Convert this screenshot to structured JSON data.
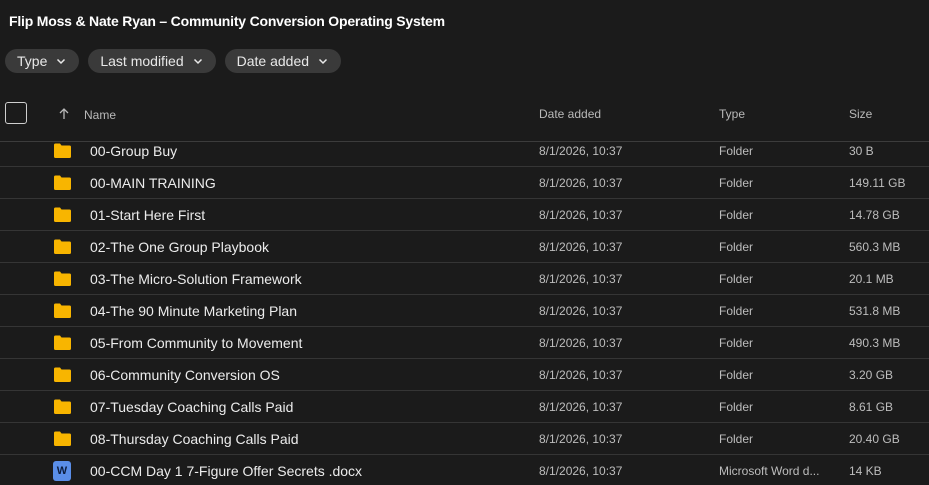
{
  "title": "Flip Moss & Nate Ryan – Community Conversion Operating System",
  "filters": [
    {
      "label": "Type",
      "icon": "chevron-down-icon"
    },
    {
      "label": "Last modified",
      "icon": "chevron-down-icon"
    },
    {
      "label": "Date added",
      "icon": "chevron-down-icon"
    }
  ],
  "columns": {
    "name": "Name",
    "date_added": "Date added",
    "type": "Type",
    "size": "Size"
  },
  "colors": {
    "folder": "#f8b500",
    "word": "#5a8ee8",
    "background": "#1b1b1b"
  },
  "rows": [
    {
      "name": "00-Group Buy",
      "date": "8/1/2026, 10:37",
      "type": "Folder",
      "size": "30 B",
      "icon": "folder-icon"
    },
    {
      "name": "00-MAIN TRAINING",
      "date": "8/1/2026, 10:37",
      "type": "Folder",
      "size": "149.11 GB",
      "icon": "folder-icon"
    },
    {
      "name": "01-Start Here First",
      "date": "8/1/2026, 10:37",
      "type": "Folder",
      "size": "14.78 GB",
      "icon": "folder-icon"
    },
    {
      "name": "02-The One Group Playbook",
      "date": "8/1/2026, 10:37",
      "type": "Folder",
      "size": "560.3 MB",
      "icon": "folder-icon"
    },
    {
      "name": "03-The Micro-Solution Framework",
      "date": "8/1/2026, 10:37",
      "type": "Folder",
      "size": "20.1 MB",
      "icon": "folder-icon"
    },
    {
      "name": "04-The 90 Minute Marketing Plan",
      "date": "8/1/2026, 10:37",
      "type": "Folder",
      "size": "531.8 MB",
      "icon": "folder-icon"
    },
    {
      "name": "05-From Community to Movement",
      "date": "8/1/2026, 10:37",
      "type": "Folder",
      "size": "490.3 MB",
      "icon": "folder-icon"
    },
    {
      "name": "06-Community Conversion OS",
      "date": "8/1/2026, 10:37",
      "type": "Folder",
      "size": "3.20 GB",
      "icon": "folder-icon"
    },
    {
      "name": "07-Tuesday Coaching Calls Paid",
      "date": "8/1/2026, 10:37",
      "type": "Folder",
      "size": "8.61 GB",
      "icon": "folder-icon"
    },
    {
      "name": "08-Thursday Coaching Calls Paid",
      "date": "8/1/2026, 10:37",
      "type": "Folder",
      "size": "20.40 GB",
      "icon": "folder-icon"
    },
    {
      "name": "00-CCM Day 1 7-Figure Offer Secrets .docx",
      "date": "8/1/2026, 10:37",
      "type": "Microsoft Word d...",
      "size": "14 KB",
      "icon": "word-doc-icon",
      "icon_letter": "W"
    }
  ]
}
